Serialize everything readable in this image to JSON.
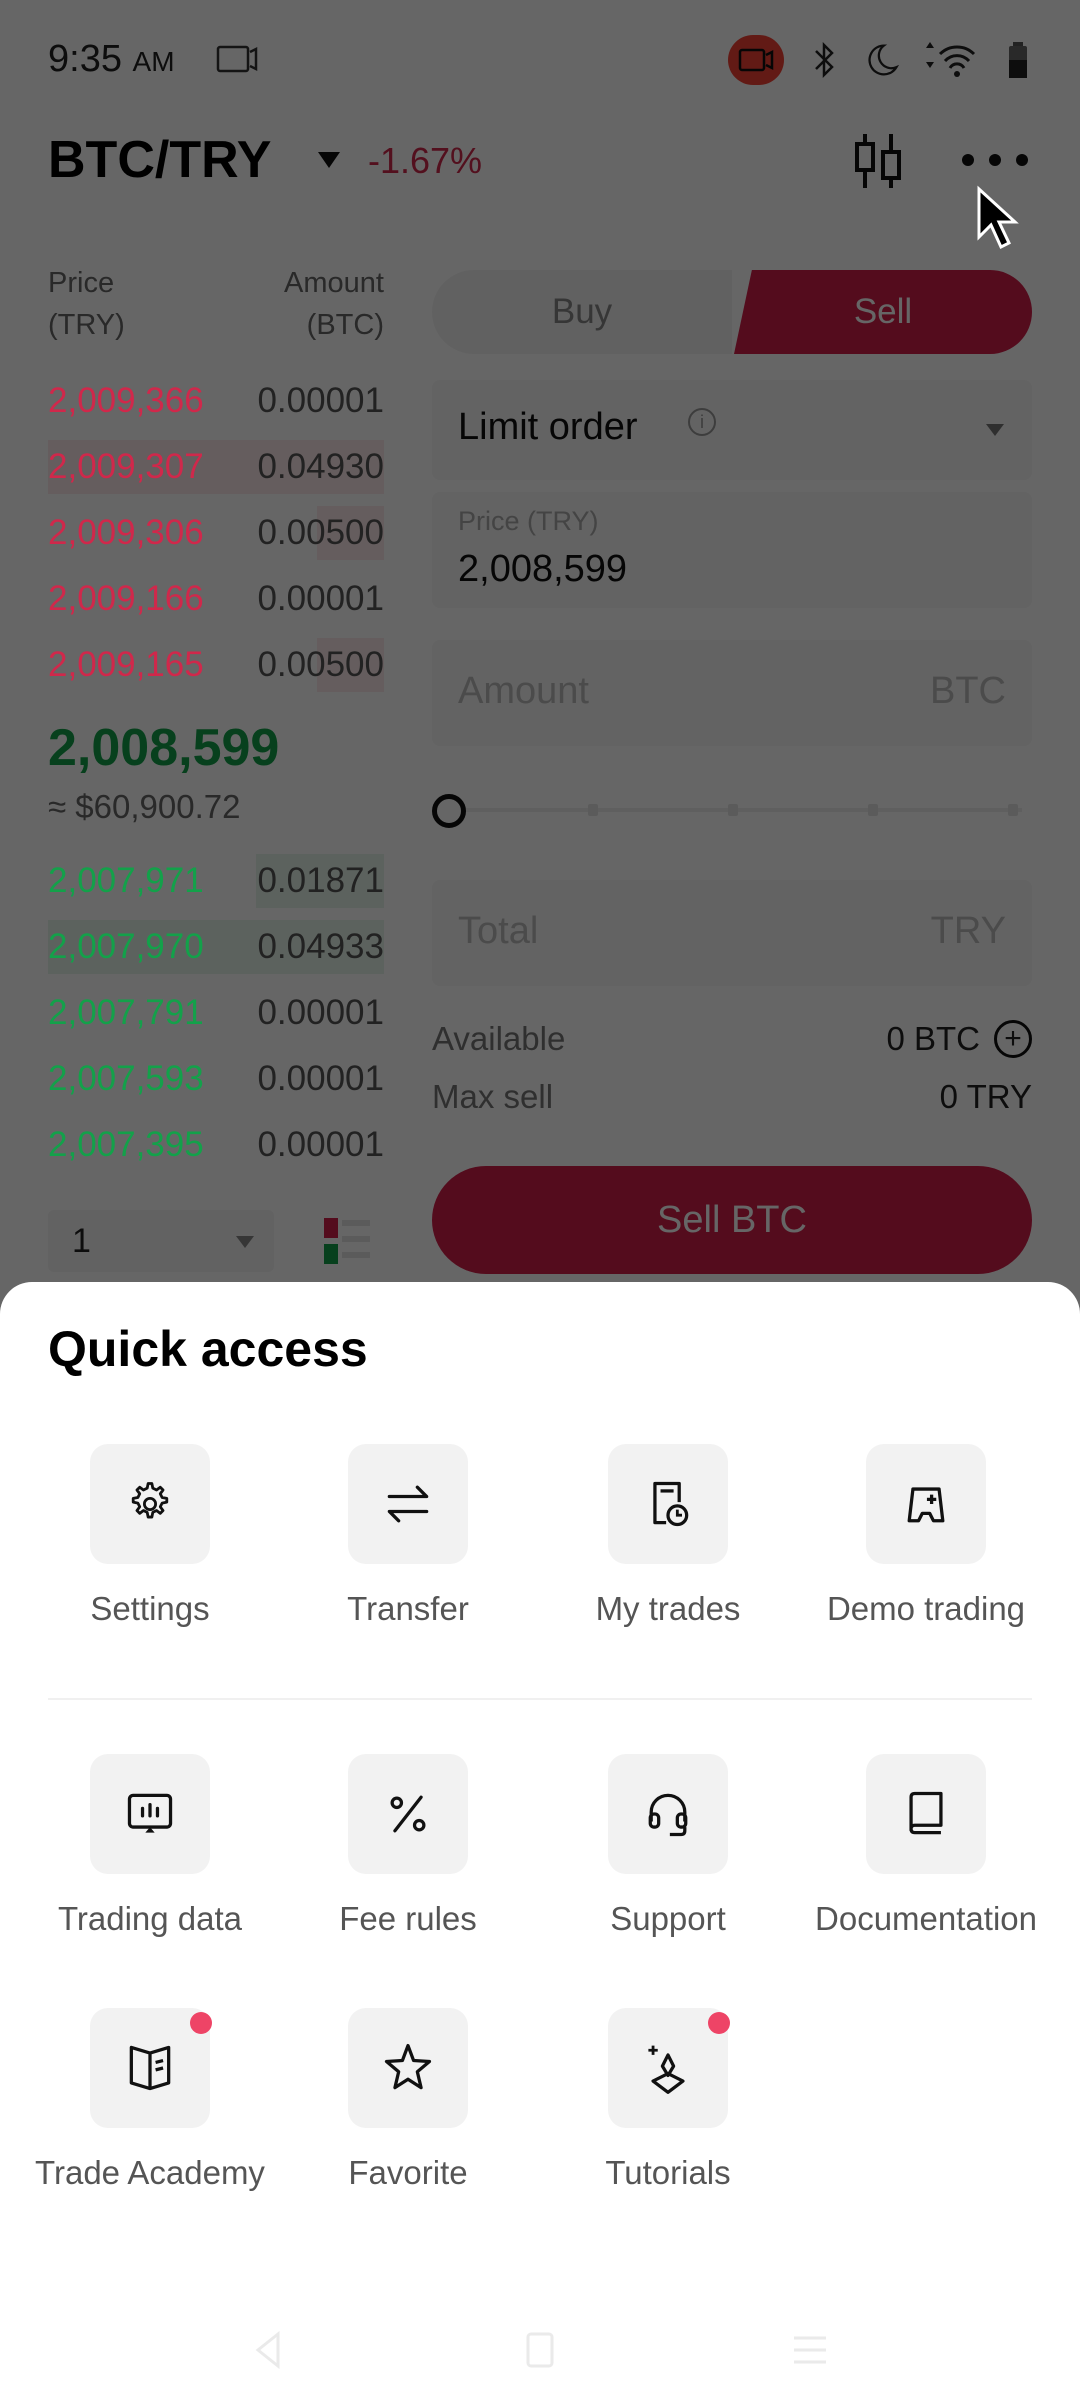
{
  "status_bar": {
    "time": "9:35",
    "ampm": "AM",
    "icons": [
      "screen-record-icon",
      "bluetooth-icon",
      "do-not-disturb-moon-icon",
      "wifi-icon",
      "battery-icon"
    ]
  },
  "header": {
    "pair": "BTC/TRY",
    "change": "-1.67%",
    "icons": [
      "candlestick-chart-icon",
      "more-options-icon"
    ]
  },
  "order_book": {
    "price_header": "Price\n(TRY)",
    "price_header_line1": "Price",
    "price_header_line2": "(TRY)",
    "amount_header_line1": "Amount",
    "amount_header_line2": "(BTC)",
    "asks": [
      {
        "price": "2,009,366",
        "amount": "0.00001",
        "depth": 0.0
      },
      {
        "price": "2,009,307",
        "amount": "0.04930",
        "depth": 1.0
      },
      {
        "price": "2,009,306",
        "amount": "0.00500",
        "depth": 0.1
      },
      {
        "price": "2,009,166",
        "amount": "0.00001",
        "depth": 0.0
      },
      {
        "price": "2,009,165",
        "amount": "0.00500",
        "depth": 0.1
      }
    ],
    "last_price": "2,008,599",
    "last_price_usd": "≈ $60,900.72",
    "bids": [
      {
        "price": "2,007,971",
        "amount": "0.01871",
        "depth": 0.38
      },
      {
        "price": "2,007,970",
        "amount": "0.04933",
        "depth": 1.0
      },
      {
        "price": "2,007,791",
        "amount": "0.00001",
        "depth": 0.0
      },
      {
        "price": "2,007,593",
        "amount": "0.00001",
        "depth": 0.0
      },
      {
        "price": "2,007,395",
        "amount": "0.00001",
        "depth": 0.0
      }
    ],
    "precision_value": "1"
  },
  "order_form": {
    "buy_label": "Buy",
    "sell_label": "Sell",
    "selected_side": "Sell",
    "order_type": "Limit order",
    "price_label": "Price (TRY)",
    "price_value": "2,008,599",
    "amount_placeholder": "Amount",
    "amount_unit": "BTC",
    "slider_percent": 0,
    "total_placeholder": "Total",
    "total_unit": "TRY",
    "available_label": "Available",
    "available_value": "0 BTC",
    "max_sell_label": "Max sell",
    "max_sell_value": "0 TRY",
    "submit_label": "Sell BTC"
  },
  "quick_access": {
    "title": "Quick access",
    "items": [
      {
        "label": "Settings",
        "icon": "gear-icon",
        "badge": false
      },
      {
        "label": "Transfer",
        "icon": "transfer-arrows-icon",
        "badge": false
      },
      {
        "label": "My trades",
        "icon": "trade-history-icon",
        "badge": false
      },
      {
        "label": "Demo trading",
        "icon": "demo-trading-icon",
        "badge": false
      },
      {
        "label": "Trading data",
        "icon": "trading-data-icon",
        "badge": false
      },
      {
        "label": "Fee rules",
        "icon": "percent-icon",
        "badge": false
      },
      {
        "label": "Support",
        "icon": "headset-icon",
        "badge": false
      },
      {
        "label": "Documentation",
        "icon": "book-icon",
        "badge": false
      },
      {
        "label": "Trade Academy",
        "icon": "open-book-icon",
        "badge": true
      },
      {
        "label": "Favorite",
        "icon": "star-icon",
        "badge": false
      },
      {
        "label": "Tutorials",
        "icon": "sparkle-diamond-icon",
        "badge": true
      }
    ]
  },
  "colors": {
    "sell_red": "#d21f4a",
    "buy_green": "#13a14a",
    "badge_pink": "#ee4466"
  }
}
